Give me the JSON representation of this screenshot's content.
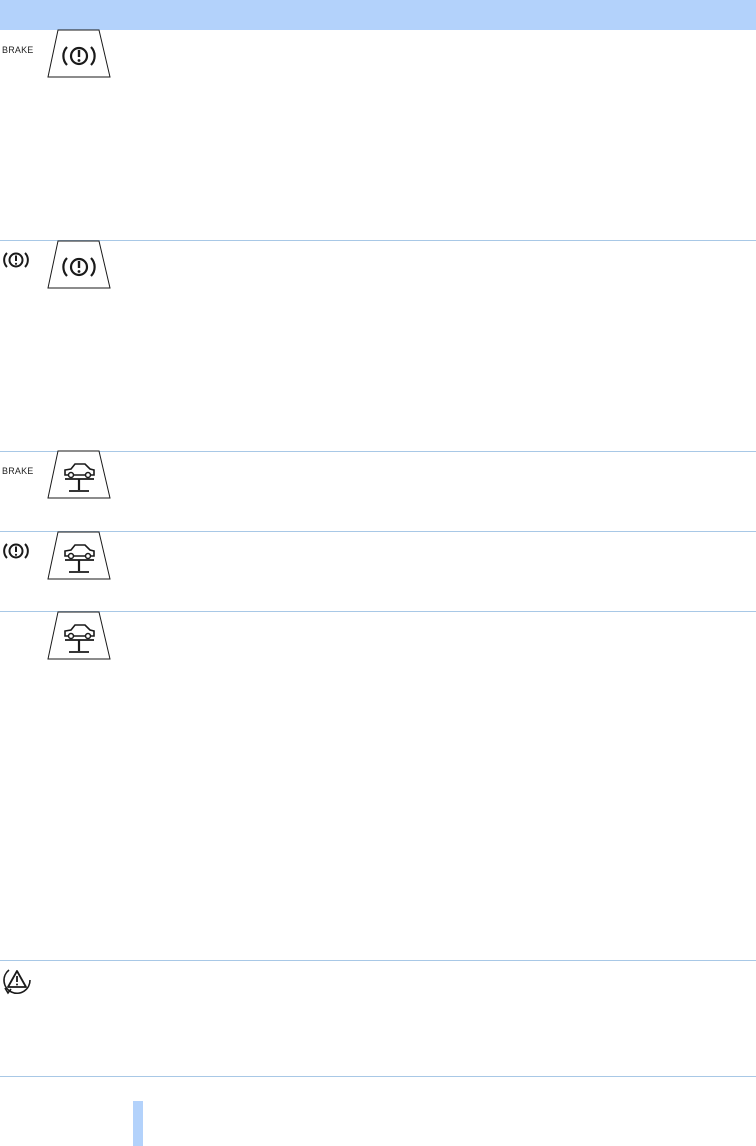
{
  "colors": {
    "header_band": "#b3d2fb",
    "divider": "#a8c8e6",
    "footer_bar": "#b3d2fb",
    "icon_stroke": "#1a1a1a"
  },
  "rows": [
    {
      "left_label": "BRAKE",
      "left_icon": null,
      "panel_icon": "brake-warning-panel-icon"
    },
    {
      "left_label": null,
      "left_icon": "brake-warning-icon",
      "panel_icon": "brake-warning-panel-icon"
    },
    {
      "left_label": "BRAKE",
      "left_icon": null,
      "panel_icon": "vehicle-lift-panel-icon"
    },
    {
      "left_label": null,
      "left_icon": "brake-warning-icon",
      "panel_icon": "vehicle-lift-panel-icon"
    },
    {
      "left_label": null,
      "left_icon": null,
      "panel_icon": "vehicle-lift-panel-icon"
    },
    {
      "left_label": null,
      "left_icon": "warning-triangle-arrow-icon",
      "panel_icon": null
    }
  ]
}
